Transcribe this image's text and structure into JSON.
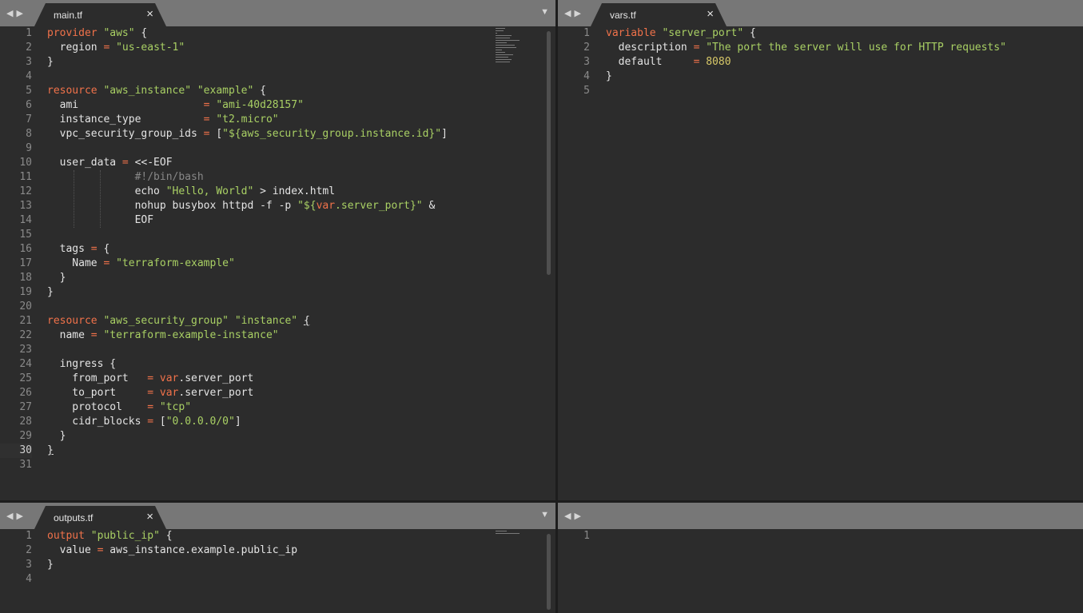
{
  "window": {
    "nav_left": "◀",
    "nav_right": "▶",
    "dropdown": "▼",
    "close": "×"
  },
  "colors": {
    "keyword": "#f1724a",
    "string": "#a9d064",
    "number": "#d7c868",
    "modified_marker": "#e1b654",
    "added_marker": "#92c05a"
  },
  "panes": {
    "main": {
      "tab_label": "main.tf",
      "line_numbers": [
        "1",
        "2",
        "3",
        "4",
        "5",
        "6",
        "7",
        "8",
        "9",
        "10",
        "11",
        "12",
        "13",
        "14",
        "15",
        "16",
        "17",
        "18",
        "19",
        "20",
        "21",
        "22",
        "23",
        "24",
        "25",
        "26",
        "27",
        "28",
        "29",
        "30",
        "31"
      ],
      "lines": [
        [
          [
            "kw",
            "provider"
          ],
          [
            "p",
            " "
          ],
          [
            "str",
            "\"aws\""
          ],
          [
            "p",
            " {"
          ]
        ],
        [
          [
            "p",
            "  region "
          ],
          [
            "kw",
            "="
          ],
          [
            "p",
            " "
          ],
          [
            "str",
            "\"us-east-1\""
          ]
        ],
        [
          [
            "p",
            "}"
          ]
        ],
        [],
        [
          [
            "kw",
            "resource"
          ],
          [
            "p",
            " "
          ],
          [
            "str",
            "\"aws_instance\""
          ],
          [
            "p",
            " "
          ],
          [
            "str",
            "\"example\""
          ],
          [
            "p",
            " {"
          ]
        ],
        [
          [
            "p",
            "  ami                    "
          ],
          [
            "kw",
            "="
          ],
          [
            "p",
            " "
          ],
          [
            "str",
            "\"ami-40d28157\""
          ]
        ],
        [
          [
            "p",
            "  instance_type          "
          ],
          [
            "kw",
            "="
          ],
          [
            "p",
            " "
          ],
          [
            "str",
            "\"t2.micro\""
          ]
        ],
        [
          [
            "p",
            "  vpc_security_group_ids "
          ],
          [
            "kw",
            "="
          ],
          [
            "p",
            " ["
          ],
          [
            "str",
            "\"${aws_security_group.instance.id}\""
          ],
          [
            "p",
            "]"
          ]
        ],
        [],
        [
          [
            "p",
            "  user_data "
          ],
          [
            "kw",
            "="
          ],
          [
            "p",
            " <<-EOF"
          ]
        ],
        [
          [
            "cm",
            "              #!/bin/bash"
          ]
        ],
        [
          [
            "p",
            "              echo "
          ],
          [
            "str",
            "\"Hello, World\""
          ],
          [
            "p",
            " > index.html"
          ]
        ],
        [
          [
            "p",
            "              nohup busybox httpd -f -p "
          ],
          [
            "str",
            "\"${"
          ],
          [
            "kw",
            "var"
          ],
          [
            "str",
            ".server_port}\""
          ],
          [
            "p",
            " &"
          ]
        ],
        [
          [
            "p",
            "              EOF"
          ]
        ],
        [],
        [
          [
            "p",
            "  tags "
          ],
          [
            "kw",
            "="
          ],
          [
            "p",
            " {"
          ]
        ],
        [
          [
            "p",
            "    Name "
          ],
          [
            "kw",
            "="
          ],
          [
            "p",
            " "
          ],
          [
            "str",
            "\"terraform-example\""
          ]
        ],
        [
          [
            "p",
            "  }"
          ]
        ],
        [
          [
            "p",
            "}"
          ]
        ],
        [],
        [
          [
            "kw",
            "resource"
          ],
          [
            "p",
            " "
          ],
          [
            "str",
            "\"aws_security_group\""
          ],
          [
            "p",
            " "
          ],
          [
            "str",
            "\"instance\""
          ],
          [
            "p",
            " "
          ],
          [
            "cur",
            "{"
          ]
        ],
        [
          [
            "p",
            "  name "
          ],
          [
            "kw",
            "="
          ],
          [
            "p",
            " "
          ],
          [
            "str",
            "\"terraform-example-instance\""
          ]
        ],
        [],
        [
          [
            "p",
            "  ingress {"
          ]
        ],
        [
          [
            "p",
            "    from_port   "
          ],
          [
            "kw",
            "="
          ],
          [
            "p",
            " "
          ],
          [
            "kw",
            "var"
          ],
          [
            "p",
            ".server_port"
          ]
        ],
        [
          [
            "p",
            "    to_port     "
          ],
          [
            "kw",
            "="
          ],
          [
            "p",
            " "
          ],
          [
            "kw",
            "var"
          ],
          [
            "p",
            ".server_port"
          ]
        ],
        [
          [
            "p",
            "    protocol    "
          ],
          [
            "kw",
            "="
          ],
          [
            "p",
            " "
          ],
          [
            "str",
            "\"tcp\""
          ]
        ],
        [
          [
            "p",
            "    cidr_blocks "
          ],
          [
            "kw",
            "="
          ],
          [
            "p",
            " ["
          ],
          [
            "str",
            "\"0.0.0.0/0\""
          ],
          [
            "p",
            "]"
          ]
        ],
        [
          [
            "p",
            "  }"
          ]
        ],
        [
          [
            "cur",
            "}"
          ]
        ],
        []
      ]
    },
    "vars": {
      "tab_label": "vars.tf",
      "line_numbers": [
        "1",
        "2",
        "3",
        "4",
        "5"
      ],
      "lines": [
        [
          [
            "kw",
            "variable"
          ],
          [
            "p",
            " "
          ],
          [
            "str",
            "\"server_port\""
          ],
          [
            "p",
            " {"
          ]
        ],
        [
          [
            "p",
            "  description "
          ],
          [
            "kw",
            "="
          ],
          [
            "p",
            " "
          ],
          [
            "str",
            "\"The port the server will use for HTTP requests\""
          ]
        ],
        [
          [
            "p",
            "  default     "
          ],
          [
            "kw",
            "="
          ],
          [
            "p",
            " "
          ],
          [
            "num",
            "8080"
          ]
        ],
        [
          [
            "p",
            "}"
          ]
        ],
        []
      ]
    },
    "outputs": {
      "tab_label": "outputs.tf",
      "line_numbers": [
        "1",
        "2",
        "3",
        "4"
      ],
      "lines": [
        [
          [
            "kw",
            "output"
          ],
          [
            "p",
            " "
          ],
          [
            "str",
            "\"public_ip\""
          ],
          [
            "p",
            " {"
          ]
        ],
        [
          [
            "p",
            "  value "
          ],
          [
            "kw",
            "="
          ],
          [
            "p",
            " aws_instance.example.public_ip"
          ]
        ],
        [
          [
            "p",
            "}"
          ]
        ],
        []
      ]
    },
    "empty": {
      "line_numbers": [
        "1"
      ]
    }
  }
}
